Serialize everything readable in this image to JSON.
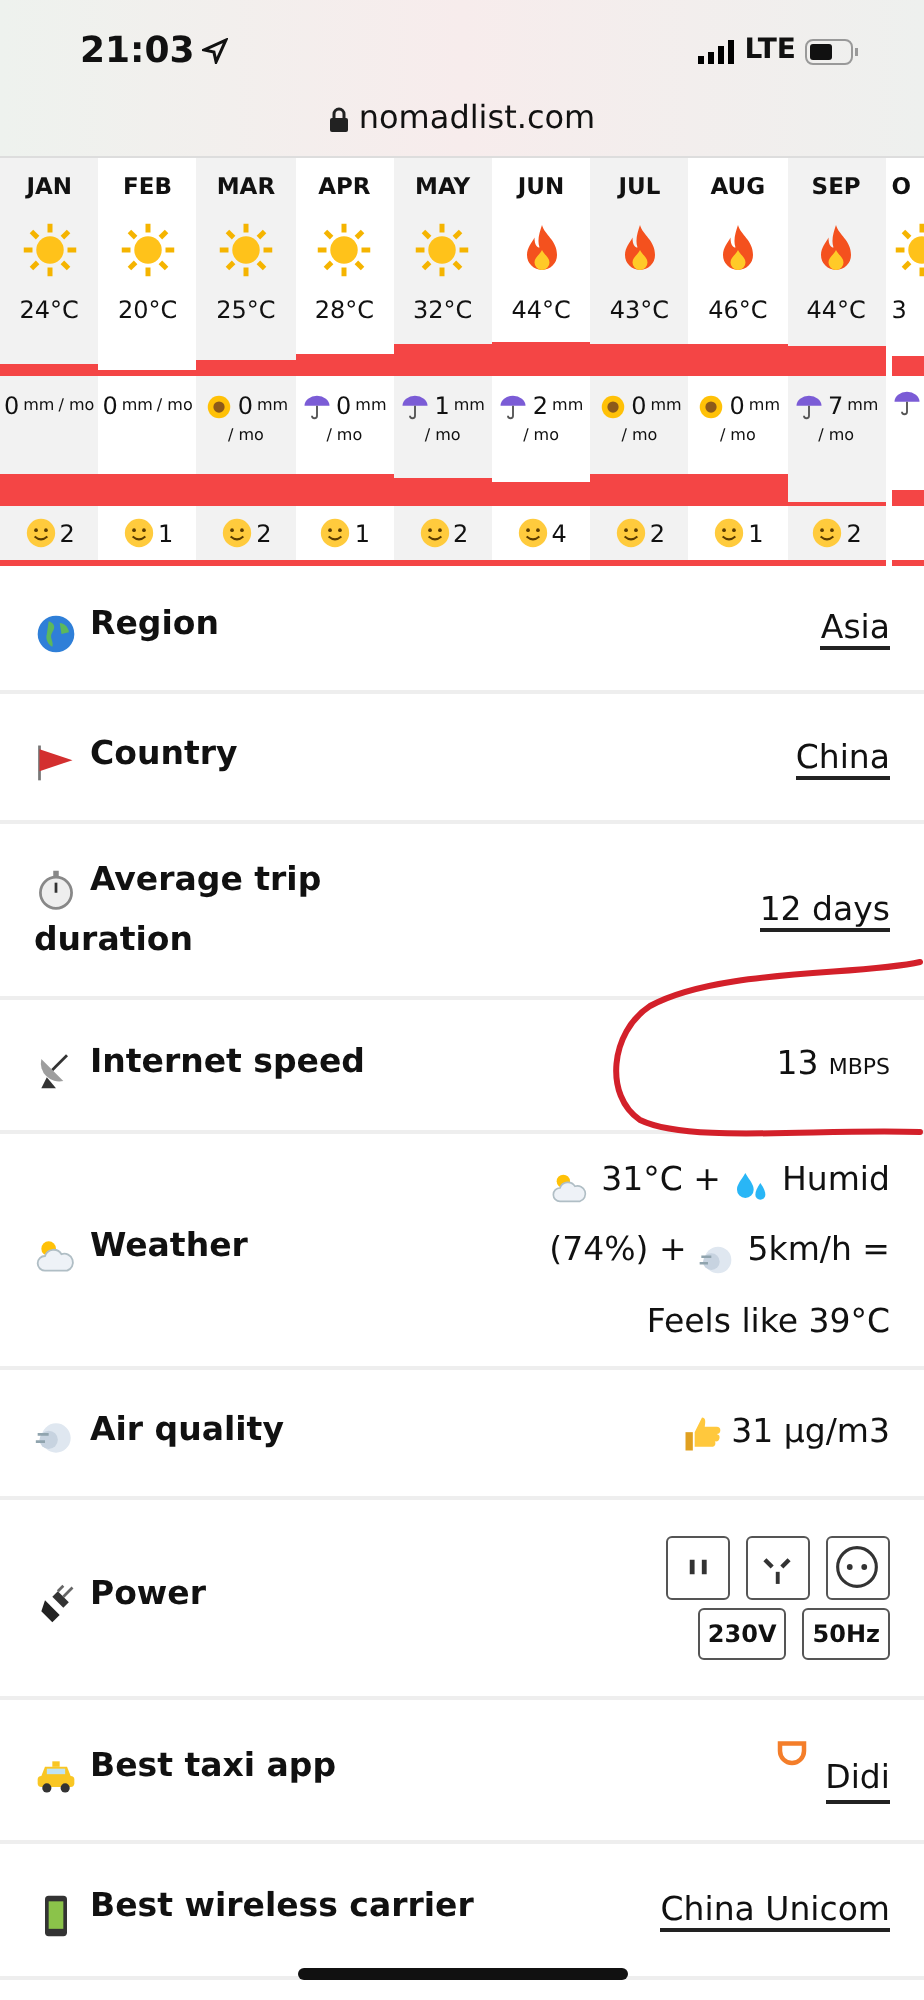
{
  "status_bar": {
    "time": "21:03",
    "network": "LTE"
  },
  "address_bar": {
    "url": "nomadlist.com"
  },
  "months": [
    {
      "label": "JAN",
      "kind": "sunny",
      "temp": "24°C",
      "rain": {
        "kind": "none",
        "value": "0",
        "unit": "mm",
        "per": "/ mo"
      },
      "score": "2"
    },
    {
      "label": "FEB",
      "kind": "sunny",
      "temp": "20°C",
      "rain": {
        "kind": "none",
        "value": "0",
        "unit": "mm",
        "per": "/ mo"
      },
      "score": "1"
    },
    {
      "label": "MAR",
      "kind": "sunny",
      "temp": "25°C",
      "rain": {
        "kind": "dry",
        "value": "0",
        "unit": "mm",
        "per": "/ mo"
      },
      "score": "2"
    },
    {
      "label": "APR",
      "kind": "sunny",
      "temp": "28°C",
      "rain": {
        "kind": "wet",
        "value": "0",
        "unit": "mm",
        "per": "/ mo"
      },
      "score": "1"
    },
    {
      "label": "MAY",
      "kind": "sunny",
      "temp": "32°C",
      "rain": {
        "kind": "wet",
        "value": "1",
        "unit": "mm",
        "per": "/ mo"
      },
      "score": "2"
    },
    {
      "label": "JUN",
      "kind": "hot",
      "temp": "44°C",
      "rain": {
        "kind": "wet",
        "value": "2",
        "unit": "mm",
        "per": "/ mo"
      },
      "score": "4"
    },
    {
      "label": "JUL",
      "kind": "hot",
      "temp": "43°C",
      "rain": {
        "kind": "dry",
        "value": "0",
        "unit": "mm",
        "per": "/ mo"
      },
      "score": "2"
    },
    {
      "label": "AUG",
      "kind": "hot",
      "temp": "46°C",
      "rain": {
        "kind": "dry",
        "value": "0",
        "unit": "mm",
        "per": "/ mo"
      },
      "score": "1"
    },
    {
      "label": "SEP",
      "kind": "hot",
      "temp": "44°C",
      "rain": {
        "kind": "wet",
        "value": "7",
        "unit": "mm",
        "per": "/ mo"
      },
      "score": "2"
    },
    {
      "label": "O",
      "kind": "sunny",
      "temp": "3",
      "rain": {
        "kind": "wet"
      }
    }
  ],
  "rows": [
    {
      "label": "Region",
      "kind": "link",
      "value": "Asia"
    },
    {
      "label": "Country",
      "kind": "link",
      "value": "China"
    },
    {
      "label": "Average trip duration",
      "kind": "link",
      "value": "12 days"
    },
    {
      "label": "Internet speed",
      "kind": "speed",
      "value": "13",
      "unit": "MBPS"
    },
    {
      "label": "Weather",
      "kind": "weather",
      "parts": [
        "31°C +",
        "Humid (74%) +",
        "5km/h = Feels like 39°C"
      ]
    },
    {
      "label": "Air quality",
      "kind": "air",
      "value": "31 μg/m3"
    },
    {
      "label": "Power",
      "kind": "power",
      "specs": [
        "230V",
        "50Hz"
      ]
    },
    {
      "label": "Best taxi app",
      "kind": "app",
      "value": "Didi"
    },
    {
      "label": "Best wireless carrier",
      "kind": "link",
      "value": "China Unicom"
    }
  ],
  "annotation": {
    "kind": "circle"
  }
}
